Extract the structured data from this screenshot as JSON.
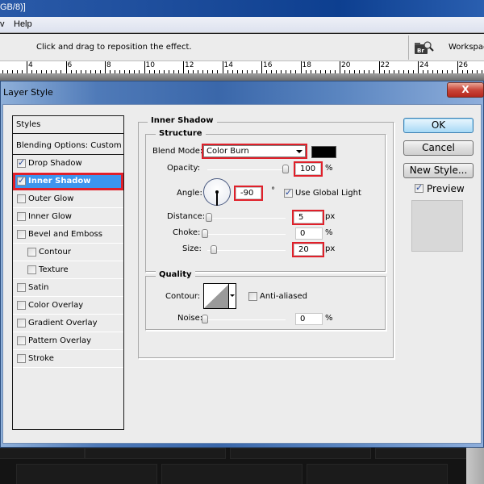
{
  "app": {
    "title_fragment": "GB/8)]",
    "menu": [
      "v",
      "Help"
    ],
    "options_hint": "Click and drag to reposition the effect.",
    "workspace_label": "Workspace",
    "bridge_icon_label": "Br",
    "ruler_labels": [
      "4",
      "6",
      "8",
      "10",
      "12",
      "14",
      "16",
      "18",
      "20",
      "22",
      "24",
      "26"
    ]
  },
  "dialog": {
    "title": "Layer Style",
    "close_label": "X",
    "styles_list": {
      "header": "Styles",
      "blending": "Blending Options: Custom",
      "items": [
        {
          "label": "Drop Shadow",
          "checked": true,
          "indent": false,
          "selected": false
        },
        {
          "label": "Inner Shadow",
          "checked": true,
          "indent": false,
          "selected": true
        },
        {
          "label": "Outer Glow",
          "checked": false,
          "indent": false,
          "selected": false
        },
        {
          "label": "Inner Glow",
          "checked": false,
          "indent": false,
          "selected": false
        },
        {
          "label": "Bevel and Emboss",
          "checked": false,
          "indent": false,
          "selected": false
        },
        {
          "label": "Contour",
          "checked": false,
          "indent": true,
          "selected": false
        },
        {
          "label": "Texture",
          "checked": false,
          "indent": true,
          "selected": false
        },
        {
          "label": "Satin",
          "checked": false,
          "indent": false,
          "selected": false
        },
        {
          "label": "Color Overlay",
          "checked": false,
          "indent": false,
          "selected": false
        },
        {
          "label": "Gradient Overlay",
          "checked": false,
          "indent": false,
          "selected": false
        },
        {
          "label": "Pattern Overlay",
          "checked": false,
          "indent": false,
          "selected": false
        },
        {
          "label": "Stroke",
          "checked": false,
          "indent": false,
          "selected": false
        }
      ]
    },
    "panel": {
      "section_title": "Inner Shadow",
      "structure": {
        "title": "Structure",
        "blend_mode_label": "Blend Mode:",
        "blend_mode_value": "Color Burn",
        "shadow_color": "#000000",
        "opacity_label": "Opacity:",
        "opacity_value": "100",
        "opacity_unit": "%",
        "opacity_fraction": 1.0,
        "angle_label": "Angle:",
        "angle_value": "-90",
        "angle_unit": "°",
        "use_global_light_label": "Use Global Light",
        "use_global_light": true,
        "distance_label": "Distance:",
        "distance_value": "5",
        "distance_unit": "px",
        "distance_fraction": 0.02,
        "choke_label": "Choke:",
        "choke_value": "0",
        "choke_unit": "%",
        "choke_fraction": 0.0,
        "size_label": "Size:",
        "size_value": "20",
        "size_unit": "px",
        "size_fraction": 0.08
      },
      "quality": {
        "title": "Quality",
        "contour_label": "Contour:",
        "anti_aliased_label": "Anti-aliased",
        "anti_aliased": false,
        "noise_label": "Noise:",
        "noise_value": "0",
        "noise_unit": "%",
        "noise_fraction": 0.0
      }
    },
    "buttons": {
      "ok": "OK",
      "cancel": "Cancel",
      "new_style": "New Style...",
      "preview_label": "Preview",
      "preview_checked": true
    },
    "highlight_color": "#e0202a",
    "selected_color": "#3d95ee"
  }
}
